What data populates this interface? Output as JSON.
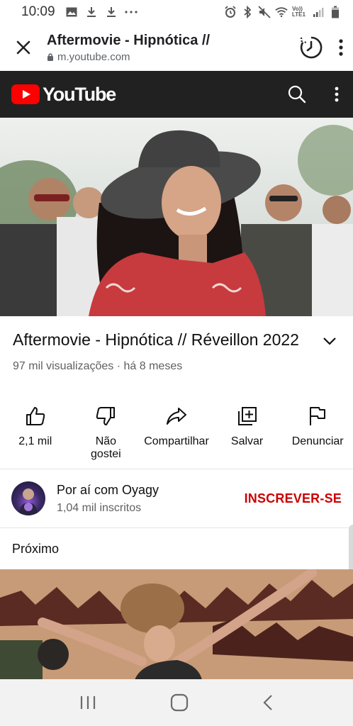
{
  "status_bar": {
    "time": "10:09",
    "left_icons": [
      "image-icon",
      "download-icon",
      "download-icon",
      "more-dots-icon"
    ],
    "right_icons": [
      "alarm-icon",
      "bluetooth-icon",
      "mute-icon",
      "wifi-icon",
      "volte-icon",
      "signal-icon",
      "battery-icon"
    ],
    "volte_text": "Vo)) LTE1"
  },
  "browser": {
    "title": "Aftermovie - Hipnótica //",
    "url": "m.youtube.com"
  },
  "youtube_header": {
    "logo_text": "YouTube",
    "brand_color": "#ff0000"
  },
  "video": {
    "title": "Aftermovie - Hipnótica // Réveillon 2022",
    "meta": "97 mil visualizações · há 8 meses"
  },
  "actions": [
    {
      "icon": "thumbs-up-icon",
      "label": "2,1 mil"
    },
    {
      "icon": "thumbs-down-icon",
      "label": "Não\ngostei"
    },
    {
      "icon": "share-icon",
      "label": "Compartilhar"
    },
    {
      "icon": "save-playlist-icon",
      "label": "Salvar"
    },
    {
      "icon": "flag-icon",
      "label": "Denunciar"
    }
  ],
  "channel": {
    "name": "Por aí com Oyagy",
    "subscribers": "1,04 mil inscritos",
    "subscribe_label": "INSCREVER-SE",
    "subscribe_color": "#cc0000"
  },
  "up_next": {
    "label": "Próximo"
  },
  "nav_bar": {
    "buttons": [
      "recent-apps-icon",
      "home-icon",
      "back-icon"
    ]
  }
}
